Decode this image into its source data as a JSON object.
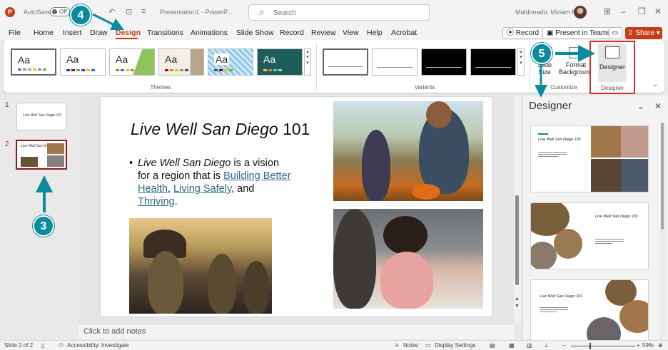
{
  "window": {
    "autosave_label": "AutoSave",
    "autosave_state": "Off",
    "doc_title": "Presentation1 - PowerP...",
    "search_placeholder": "Search",
    "user_name": "Maldonado, Miriam M"
  },
  "tabs": [
    {
      "label": "File"
    },
    {
      "label": "Home"
    },
    {
      "label": "Insert"
    },
    {
      "label": "Draw"
    },
    {
      "label": "Design"
    },
    {
      "label": "Transitions"
    },
    {
      "label": "Animations"
    },
    {
      "label": "Slide Show"
    },
    {
      "label": "Record"
    },
    {
      "label": "Review"
    },
    {
      "label": "View"
    },
    {
      "label": "Help"
    },
    {
      "label": "Acrobat"
    }
  ],
  "toolbar": {
    "record_label": "Record",
    "present_label": "Present in Teams",
    "share_label": "Share"
  },
  "ribbon": {
    "themes_group": "Themes",
    "variants_group": "Variants",
    "customize_group": "Customize",
    "designer_group": "Designer",
    "theme_label": "Aa",
    "slide_size_label": "Slide Size",
    "format_bg_label": "Format Background",
    "designer_label": "Designer"
  },
  "slides": [
    {
      "number": "1",
      "title": "Live Well San Diego 101"
    },
    {
      "number": "2",
      "title": "Live Well San Diego 101"
    }
  ],
  "current_slide": {
    "title_italic": "Live Well San Diego",
    "title_rest": " 101",
    "bullet_italic": "Live Well San Diego",
    "bullet_text_1": " is a vision for a region that is ",
    "link_1": "Building Better Health",
    "bullet_text_2": ", ",
    "link_2": "Living Safely",
    "bullet_text_3": ", and ",
    "link_3": "Thriving",
    "bullet_text_4": "."
  },
  "notes_placeholder": "Click to add notes",
  "designer_pane": {
    "title": "Designer",
    "card_title": "Live Well San Diego 101"
  },
  "statusbar": {
    "slide_info": "Slide 2 of 2",
    "accessibility": "Accessibility: Investigate",
    "notes": "Notes",
    "display_settings": "Display Settings",
    "zoom": "59%"
  },
  "callouts": [
    "3",
    "4",
    "5"
  ],
  "colors": {
    "accent": "#c43e1c",
    "callout": "#0c8b9e",
    "link": "#2e6b8a",
    "highlight": "#d32f2f"
  }
}
